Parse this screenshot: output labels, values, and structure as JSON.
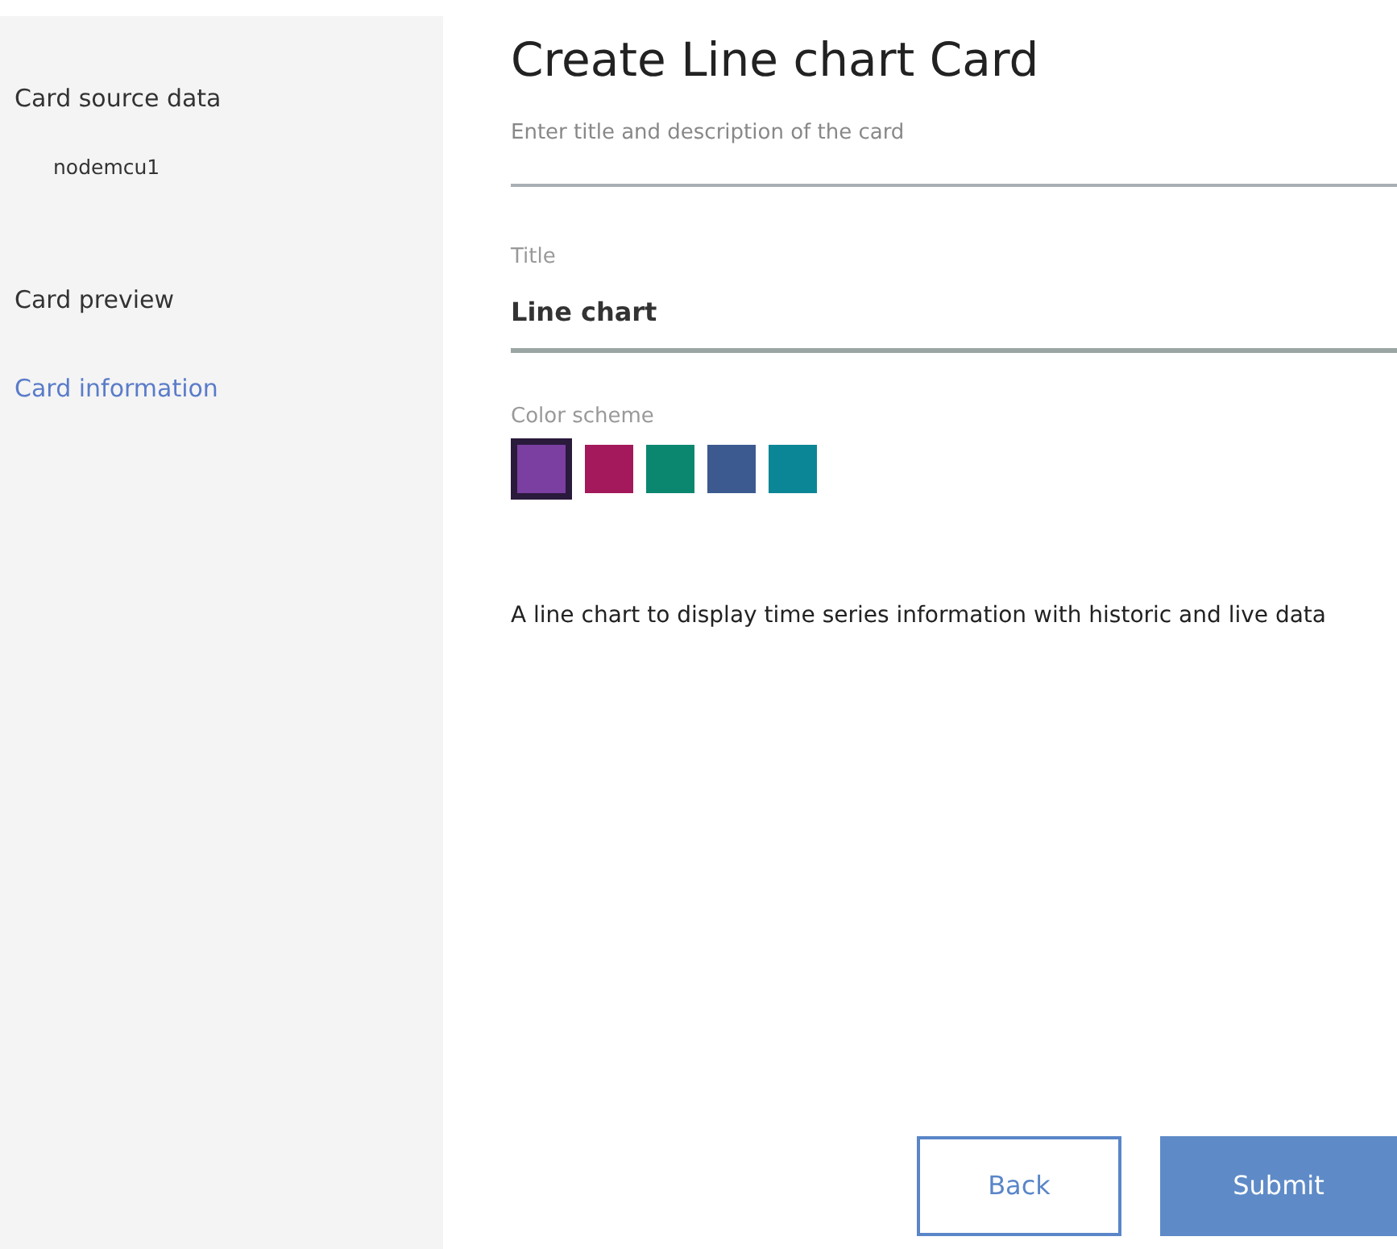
{
  "sidebar": {
    "items": [
      {
        "label": "Card source data",
        "kind": "step",
        "selected": false
      },
      {
        "label": "nodemcu1",
        "kind": "sub",
        "selected": false
      },
      {
        "label": "Card preview",
        "kind": "step",
        "selected": false
      },
      {
        "label": "Card information",
        "kind": "step",
        "selected": true
      }
    ]
  },
  "main": {
    "title": "Create Line chart Card",
    "subtitle": "Enter title and description of the card",
    "title_field": {
      "label": "Title",
      "value": "Line chart"
    },
    "color_scheme": {
      "label": "Color scheme",
      "swatches": [
        {
          "color": "#7a3fa0",
          "selected": true
        },
        {
          "color": "#a3195b",
          "selected": false
        },
        {
          "color": "#0b8770",
          "selected": false
        },
        {
          "color": "#3c5a8f",
          "selected": false
        },
        {
          "color": "#0b8696",
          "selected": false
        }
      ]
    },
    "description": "A line chart to display time series information with historic and live data",
    "buttons": [
      {
        "label": "Back",
        "kind": "secondary"
      },
      {
        "label": "Submit",
        "kind": "primary"
      }
    ]
  }
}
